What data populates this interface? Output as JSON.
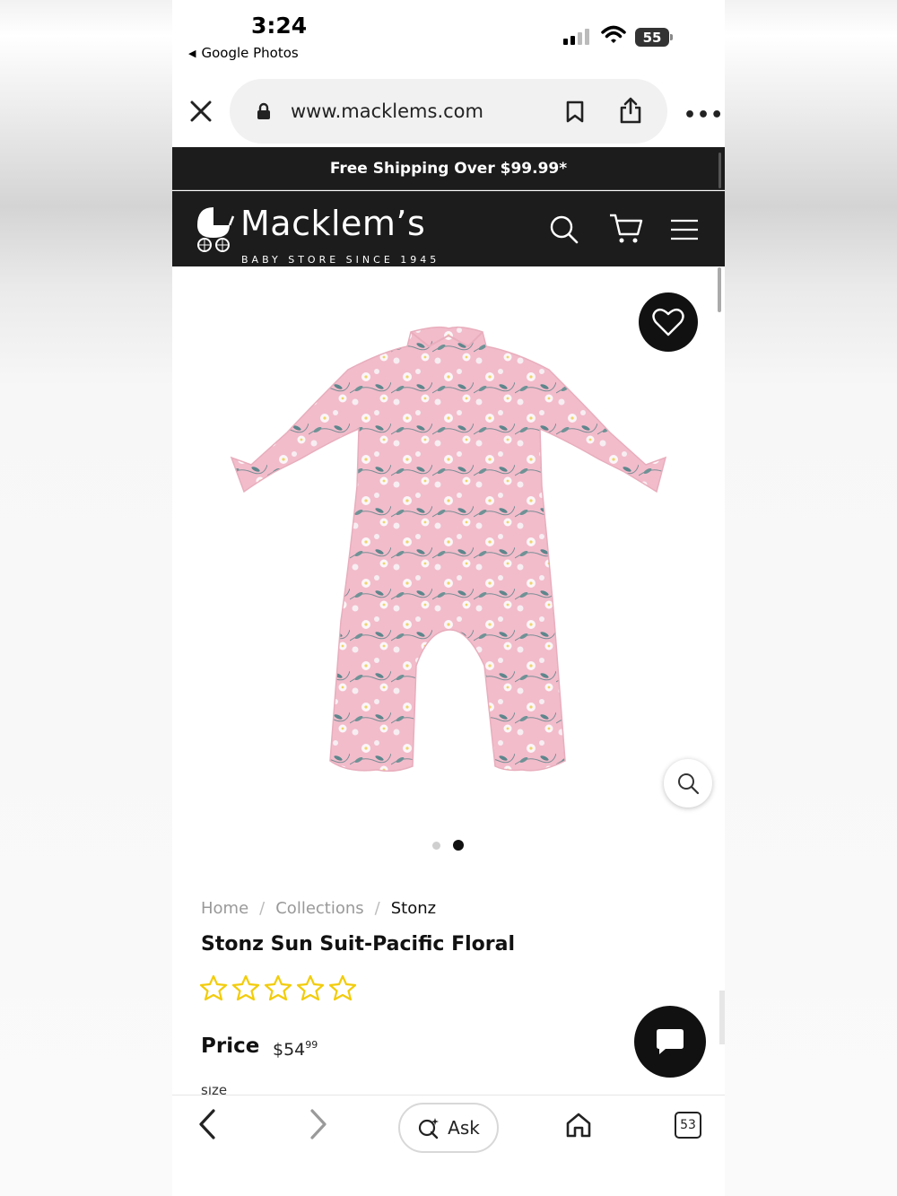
{
  "status_bar": {
    "time": "3:24",
    "back_app": "Google Photos",
    "battery": "55"
  },
  "browser": {
    "url": "www.macklems.com",
    "icons": [
      "close-icon",
      "lock-icon",
      "bookmark-icon",
      "share-icon",
      "more-icon"
    ]
  },
  "promo": {
    "text": "Free Shipping Over $99.99*"
  },
  "header": {
    "brand": "Macklem’s",
    "tagline": "BABY STORE SINCE 1945",
    "icons": [
      "search-icon",
      "cart-icon",
      "menu-icon"
    ]
  },
  "product": {
    "image_alt": "Pink floral one-piece sun suit",
    "gallery_dots": 2,
    "active_dot": 2,
    "breadcrumb": [
      "Home",
      "Collections",
      "Stonz"
    ],
    "title": "Stonz Sun Suit-Pacific Floral",
    "rating": 0,
    "rating_max": 5,
    "price_label": "Price",
    "price_main": "$54",
    "price_cents": "99",
    "size_label": "size"
  },
  "bottom_bar": {
    "ask_label": "Ask",
    "tab_count": "53"
  },
  "colors": {
    "header_bg": "#1c1c1c",
    "star": "#f2cc0c",
    "suit_pink": "#f2bccb"
  }
}
